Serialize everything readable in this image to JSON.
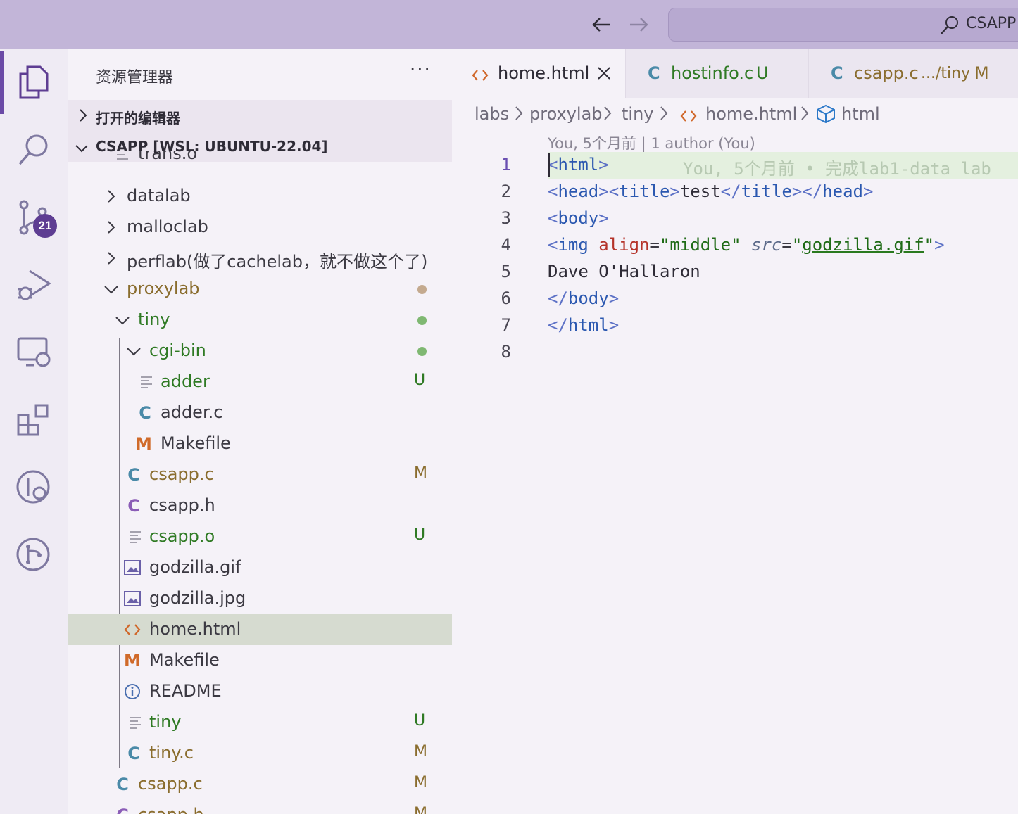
{
  "search": {
    "text": "CSAPP"
  },
  "activity": {
    "scm_badge": "21"
  },
  "explorer": {
    "title": "资源管理器",
    "more": "···",
    "open_editors": "打开的编辑器",
    "workspace": "CSAPP [WSL: UBUNTU-22.04]",
    "items": [
      {
        "label": "trans.o",
        "status": ""
      },
      {
        "label": "datalab",
        "status": ""
      },
      {
        "label": "malloclab",
        "status": ""
      },
      {
        "label": "perflab(做了cachelab，就不做这个了)",
        "status": ""
      },
      {
        "label": "proxylab",
        "status": ""
      },
      {
        "label": "tiny",
        "status": ""
      },
      {
        "label": "cgi-bin",
        "status": ""
      },
      {
        "label": "adder",
        "status": "U"
      },
      {
        "label": "adder.c",
        "status": ""
      },
      {
        "label": "Makefile",
        "status": ""
      },
      {
        "label": "csapp.c",
        "status": "M"
      },
      {
        "label": "csapp.h",
        "status": ""
      },
      {
        "label": "csapp.o",
        "status": "U"
      },
      {
        "label": "godzilla.gif",
        "status": ""
      },
      {
        "label": "godzilla.jpg",
        "status": ""
      },
      {
        "label": "home.html",
        "status": ""
      },
      {
        "label": "Makefile",
        "status": ""
      },
      {
        "label": "README",
        "status": ""
      },
      {
        "label": "tiny",
        "status": "U"
      },
      {
        "label": "tiny.c",
        "status": "M"
      },
      {
        "label": "csapp.c",
        "status": "M"
      },
      {
        "label": "csapp.h",
        "status": "M"
      }
    ]
  },
  "tabs": [
    {
      "icon": "<>",
      "label": "home.html",
      "status": ""
    },
    {
      "icon": "C",
      "label": "hostinfo.c",
      "status": "U"
    },
    {
      "icon": "C",
      "label": "csapp.c",
      "path": ".../tiny",
      "status": "M"
    }
  ],
  "breadcrumb": [
    "labs",
    "proxylab",
    "tiny",
    "home.html",
    "html"
  ],
  "blame": "You, 5个月前 | 1 author (You)",
  "inline_blame": "You, 5个月前 • 完成lab1-data lab",
  "code": {
    "line_numbers": [
      "1",
      "2",
      "3",
      "4",
      "5",
      "6",
      "7",
      "8"
    ],
    "l1": {
      "open": "<",
      "tag": "html",
      "close": ">"
    },
    "l2": {
      "a": "<",
      "b": "head",
      "c": ">",
      "d": "<",
      "e": "title",
      "f": ">",
      "g": "test",
      "h": "</",
      "i": "title",
      "j": ">",
      "k": "</",
      "l": "head",
      "m": ">"
    },
    "l3": {
      "a": "<",
      "b": "body",
      "c": ">"
    },
    "l4": {
      "a": "<",
      "b": "img",
      "sp1": " ",
      "c": "align",
      "d": "=",
      "e": "\"middle\"",
      "sp2": " ",
      "f": "src",
      "g": "=",
      "h": "\"",
      "i": "godzilla.gif",
      "j": "\"",
      "k": ">"
    },
    "l5": "Dave O'Hallaron",
    "l6": {
      "a": "</",
      "b": "body",
      "c": ">"
    },
    "l7": {
      "a": "</",
      "b": "html",
      "c": ">"
    }
  }
}
